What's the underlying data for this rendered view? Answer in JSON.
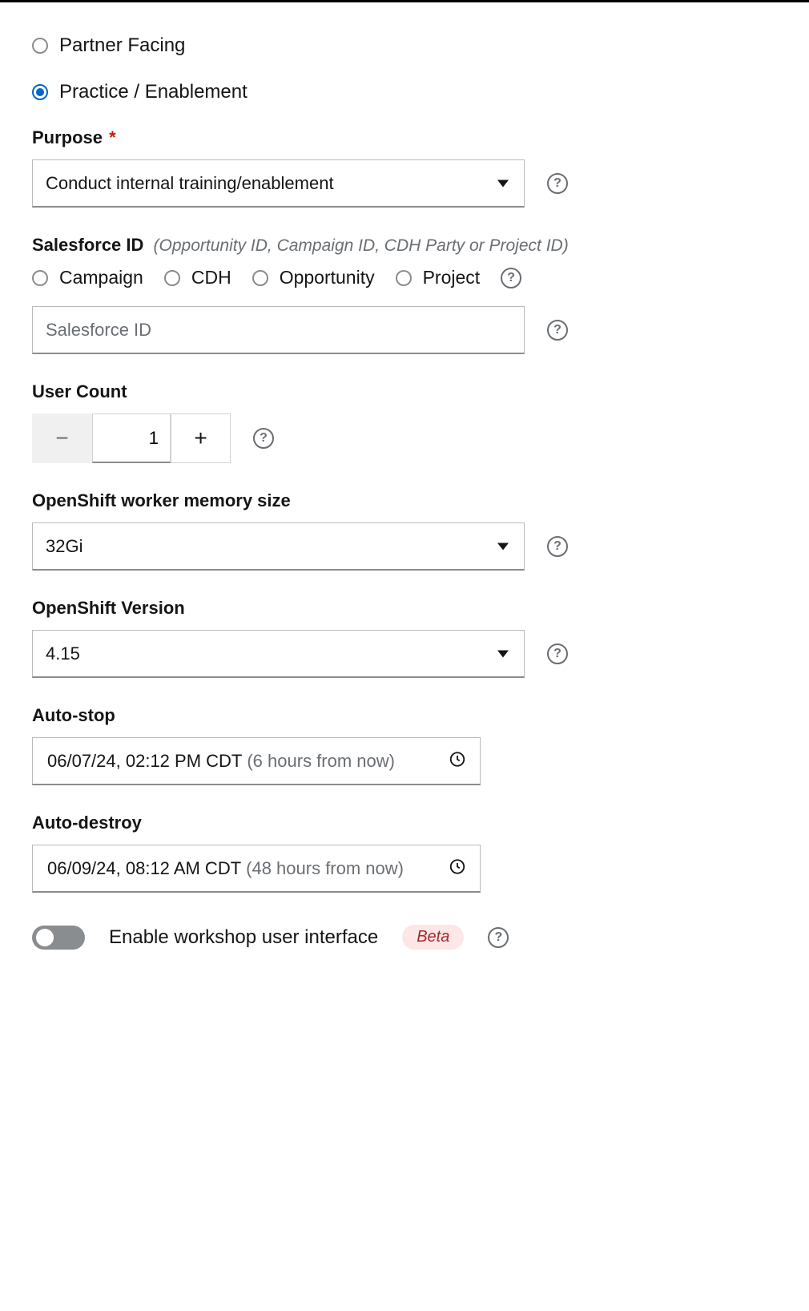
{
  "audience": {
    "options": [
      {
        "label": "Partner Facing",
        "value": "partner",
        "selected": false
      },
      {
        "label": "Practice / Enablement",
        "value": "practice",
        "selected": true
      }
    ]
  },
  "purpose": {
    "label": "Purpose",
    "required_marker": "*",
    "value": "Conduct internal training/enablement"
  },
  "salesforce": {
    "label": "Salesforce ID",
    "hint": "(Opportunity ID, Campaign ID, CDH Party or Project ID)",
    "types": [
      {
        "label": "Campaign"
      },
      {
        "label": "CDH"
      },
      {
        "label": "Opportunity"
      },
      {
        "label": "Project"
      }
    ],
    "placeholder": "Salesforce ID",
    "value": ""
  },
  "user_count": {
    "label": "User Count",
    "value": "1",
    "minus": "−",
    "plus": "+"
  },
  "worker_memory": {
    "label": "OpenShift worker memory size",
    "value": "32Gi"
  },
  "openshift_version": {
    "label": "OpenShift Version",
    "value": "4.15"
  },
  "auto_stop": {
    "label": "Auto-stop",
    "value": "06/07/24, 02:12 PM CDT",
    "relative": "(6 hours from now)"
  },
  "auto_destroy": {
    "label": "Auto-destroy",
    "value": "06/09/24, 08:12 AM CDT",
    "relative": "(48 hours from now)"
  },
  "workshop_ui": {
    "label": "Enable workshop user interface",
    "badge": "Beta",
    "enabled": false
  },
  "help_glyph": "?"
}
